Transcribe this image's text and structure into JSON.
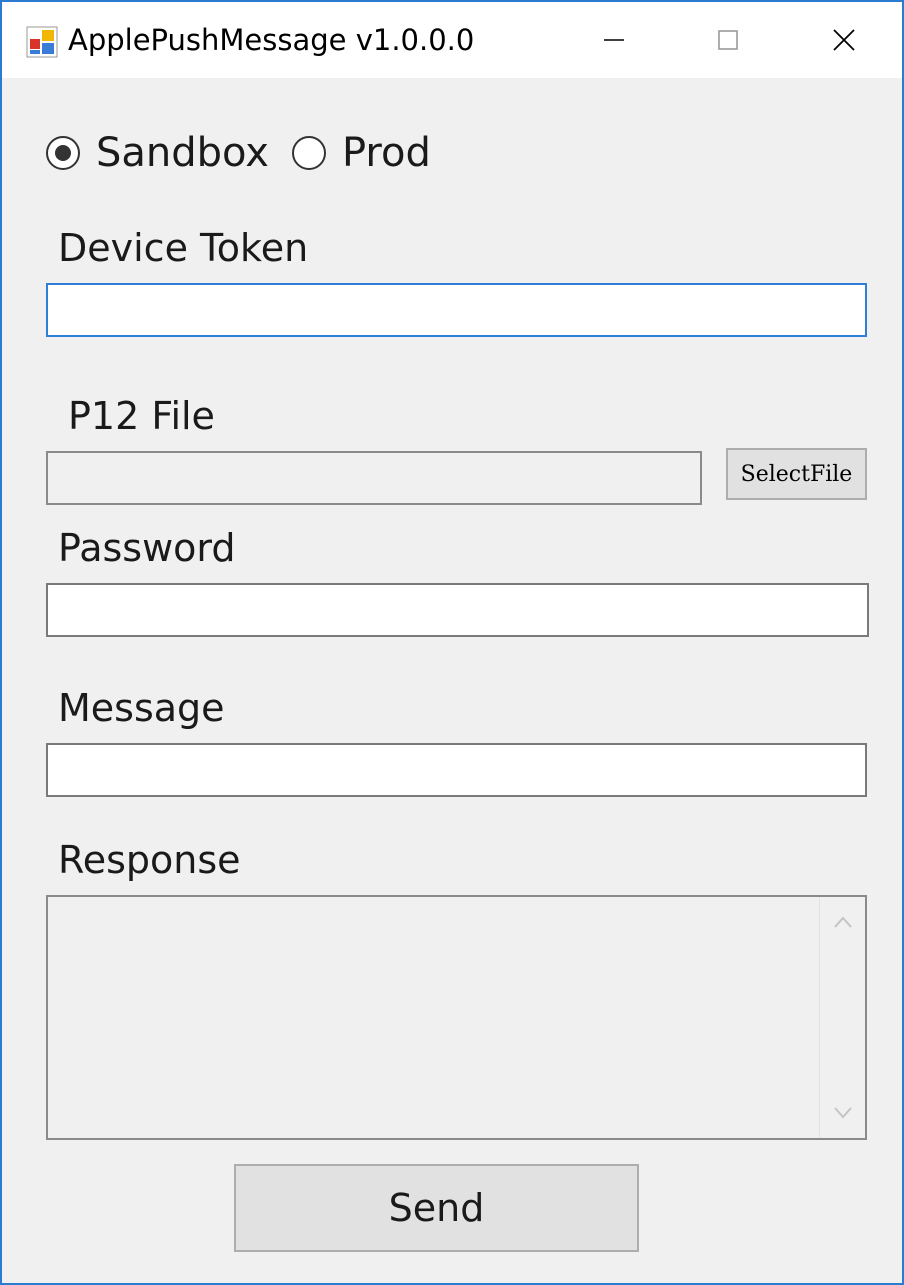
{
  "window": {
    "title": "ApplePushMessage v1.0.0.0",
    "icon": "application-icon",
    "controls": [
      "minimize-icon",
      "maximize-icon",
      "close-icon"
    ],
    "accent_color": "#2b7bd0"
  },
  "mode": {
    "options": [
      {
        "label": "Sandbox",
        "checked": true
      },
      {
        "label": "Prod",
        "checked": false
      }
    ]
  },
  "fields": {
    "device_token": {
      "label": "Device Token",
      "value": ""
    },
    "p12_file": {
      "label": "P12 File",
      "value": "",
      "button_label": "SelectFile"
    },
    "password": {
      "label": "Password",
      "value": ""
    },
    "message": {
      "label": "Message",
      "value": ""
    },
    "response": {
      "label": "Response",
      "value": ""
    }
  },
  "actions": {
    "send_label": "Send"
  }
}
